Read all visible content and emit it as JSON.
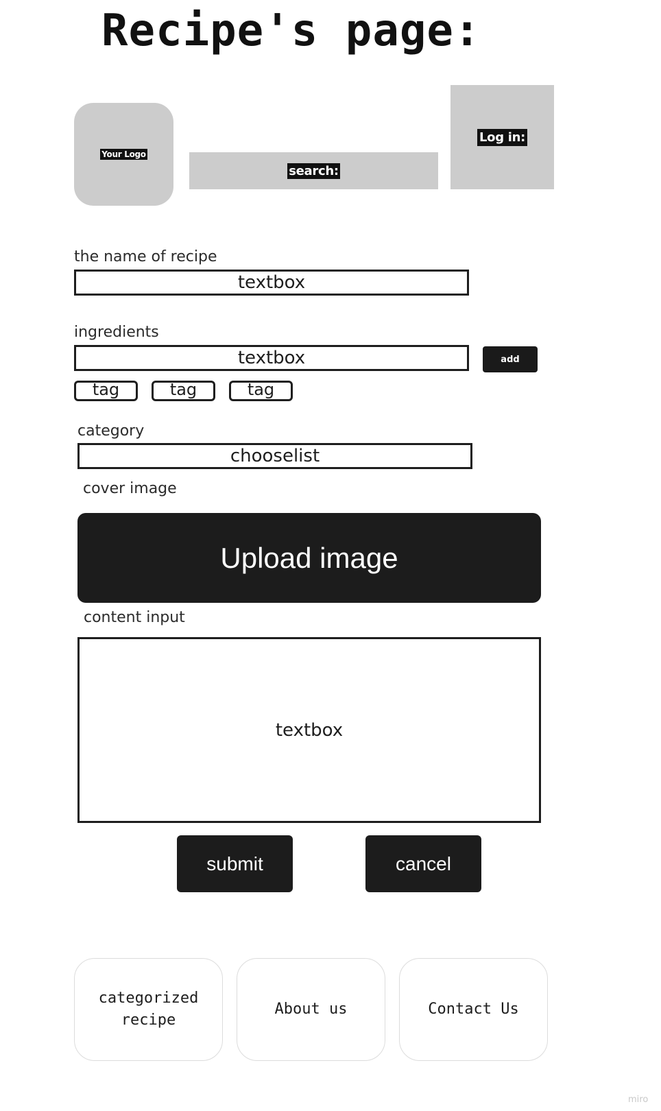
{
  "page": {
    "title": "Recipe's page:"
  },
  "header": {
    "logo_text": "Your Logo",
    "search_label": "search:",
    "login_label": "Log in:"
  },
  "form": {
    "name": {
      "label": "the name of recipe",
      "value": "textbox"
    },
    "ingredients": {
      "label": "ingredients",
      "value": "textbox",
      "add_label": "add",
      "tags": [
        "tag",
        "tag",
        "tag"
      ]
    },
    "category": {
      "label": "category",
      "value": "chooselist"
    },
    "cover": {
      "label": "cover image",
      "button_label": "Upload image"
    },
    "content": {
      "label": "content input",
      "value": "textbox"
    },
    "submit_label": "submit",
    "cancel_label": "cancel"
  },
  "footer": {
    "items": [
      {
        "label": "categorized\nrecipe"
      },
      {
        "label": "About us"
      },
      {
        "label": "Contact Us"
      }
    ]
  },
  "watermark": "miro"
}
